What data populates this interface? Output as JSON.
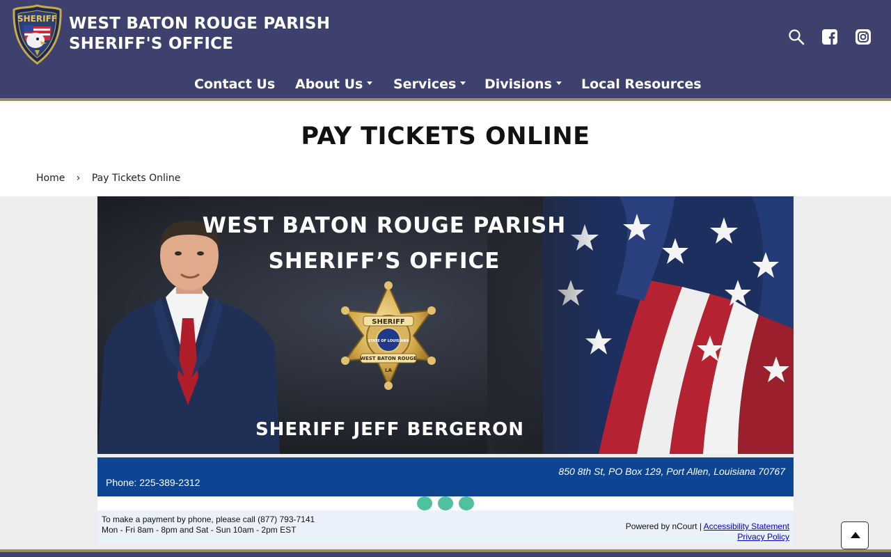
{
  "header": {
    "title_line1": "WEST BATON ROUGE PARISH",
    "title_line2": "SHERIFF'S OFFICE",
    "badge_text": "SHERIFF",
    "badge_subtext": "WEST BATON ROUGE",
    "icons": [
      "search-icon",
      "facebook-icon",
      "instagram-icon"
    ]
  },
  "nav": {
    "items": [
      {
        "label": "Contact Us",
        "dropdown": false
      },
      {
        "label": "About Us",
        "dropdown": true
      },
      {
        "label": "Services",
        "dropdown": true
      },
      {
        "label": "Divisions",
        "dropdown": true
      },
      {
        "label": "Local Resources",
        "dropdown": false
      }
    ]
  },
  "page": {
    "title": "PAY TICKETS ONLINE"
  },
  "breadcrumb": {
    "home": "Home",
    "separator": "›",
    "current": "Pay Tickets Online"
  },
  "banner": {
    "line1": "WEST BATON ROUGE PARISH",
    "line2": "SHERIFF’S OFFICE",
    "star_top": "SHERIFF",
    "star_middle": "STATE OF LOUISIANA",
    "star_bottom": "WEST BATON ROUGE",
    "star_la": "LA",
    "caption": "SHERIFF JEFF BERGERON"
  },
  "contact": {
    "address": "850 8th St, PO Box 129, Port Allen, Louisiana 70767",
    "phone": "Phone: 225-389-2312"
  },
  "payment": {
    "line1": "To make a payment by phone, please call (877) 793-7141",
    "line2": "Mon - Fri 8am - 8pm and Sat - Sun 10am - 2pm EST",
    "powered": "Powered by nCourt | ",
    "accessibility": "Accessibility Statement",
    "privacy": "Privacy Policy"
  },
  "colors": {
    "header_bg": "#3e416e",
    "gold_rule": "#9a8c5e",
    "contact_bar": "#0d4592",
    "dot": "#4fc0a0",
    "link": "#0000cc"
  }
}
